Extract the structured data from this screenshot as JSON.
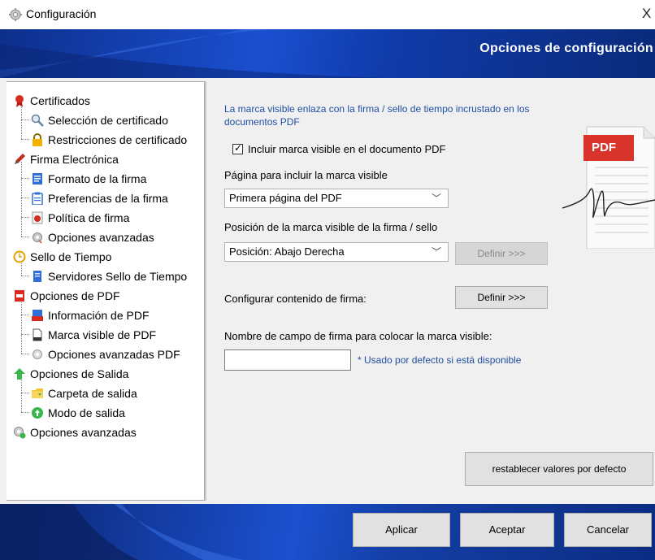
{
  "window": {
    "title": "Configuración",
    "close_glyph": "X"
  },
  "header": {
    "title": "Opciones de configuración"
  },
  "tree": {
    "items": [
      {
        "label": "Certificados",
        "icon": "ribbon-icon"
      },
      {
        "label": "Selección de certificado",
        "icon": "magnifier-icon"
      },
      {
        "label": "Restricciones de certificado",
        "icon": "lock-icon"
      },
      {
        "label": "Firma Electrónica",
        "icon": "pen-icon"
      },
      {
        "label": "Formato de la firma",
        "icon": "document-icon"
      },
      {
        "label": "Preferencias de la firma",
        "icon": "clipboard-icon"
      },
      {
        "label": "Política de firma",
        "icon": "policy-icon"
      },
      {
        "label": "Opciones avanzadas",
        "icon": "gear-icon"
      },
      {
        "label": "Sello de Tiempo",
        "icon": "clock-icon"
      },
      {
        "label": "Servidores Sello de Tiempo",
        "icon": "server-icon"
      },
      {
        "label": "Opciones de PDF",
        "icon": "pdf-red-icon"
      },
      {
        "label": "Información de PDF",
        "icon": "pdf-info-icon"
      },
      {
        "label": "Marca visible de PDF",
        "icon": "page-icon"
      },
      {
        "label": "Opciones avanzadas PDF",
        "icon": "gear-icon"
      },
      {
        "label": "Opciones de Salida",
        "icon": "up-arrow-icon"
      },
      {
        "label": "Carpeta de salida",
        "icon": "folder-icon"
      },
      {
        "label": "Modo de salida",
        "icon": "green-circle-icon"
      },
      {
        "label": "Opciones avanzadas",
        "icon": "gear-icon"
      }
    ]
  },
  "content": {
    "info_text": "La marca visible enlaza con la firma / sello de tiempo incrustado en los documentos PDF",
    "include_checkbox_label": "Incluir marca visible en el documento PDF",
    "include_checked": true,
    "page_label": "Página para incluir la marca visible",
    "page_select_value": "Primera página del PDF",
    "position_label": "Posición de la marca visible de la firma / sello",
    "position_select_value": "Posición: Abajo Derecha",
    "define_button_1": "Definir >>>",
    "content_label": "Configurar contenido de firma:",
    "define_button_2": "Definir >>>",
    "field_name_label": "Nombre de campo de firma para colocar la marca visible:",
    "field_name_value": "",
    "field_name_hint": "* Usado por defecto si está disponible",
    "reset_button": "restablecer valores por defecto",
    "pdf_badge": "PDF"
  },
  "footer": {
    "apply": "Aplicar",
    "accept": "Aceptar",
    "cancel": "Cancelar"
  },
  "colors": {
    "header_blue": "#1a4fd0",
    "info_text": "#1f4fa5",
    "pdf_badge_red": "#d9342b"
  }
}
